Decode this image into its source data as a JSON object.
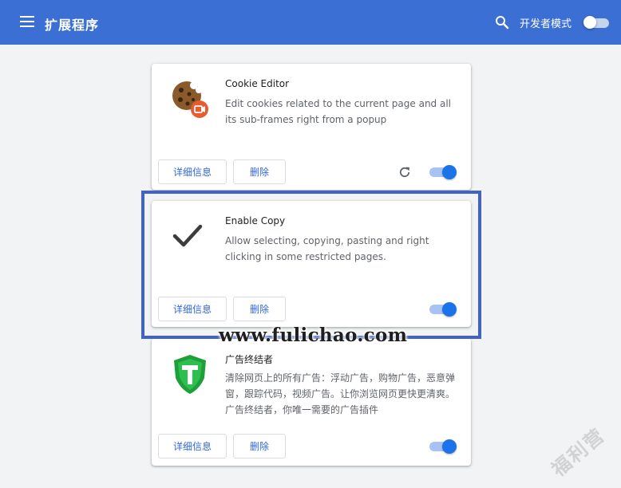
{
  "header": {
    "title": "扩展程序",
    "dev_mode_label": "开发者模式",
    "dev_mode_enabled": false,
    "color": "#3b6fd3"
  },
  "extensions": [
    {
      "name": "Cookie Editor",
      "description": "Edit cookies related to the current page and all its sub-frames right from a popup",
      "details_label": "详细信息",
      "remove_label": "删除",
      "enabled": true,
      "icon": "cookie-icon",
      "has_reload": true
    },
    {
      "name": "Enable Copy",
      "description": "Allow selecting, copying, pasting and right clicking in some restricted pages.",
      "details_label": "详细信息",
      "remove_label": "删除",
      "enabled": true,
      "icon": "checkmark-icon",
      "has_reload": false
    },
    {
      "name": "广告终结者",
      "description": "清除网页上的所有广告：浮动广告，购物广告，恶意弹窗，跟踪代码，视频广告。让你浏览网页更快更清爽。广告终结者，你唯一需要的广告插件",
      "details_label": "详细信息",
      "remove_label": "删除",
      "enabled": true,
      "icon": "shield-t-icon",
      "has_reload": false
    }
  ],
  "watermark": "www.fulichao.com",
  "corner_watermark": "福利营",
  "accent_color": "#1a73e8",
  "highlight_color": "#3f63c8"
}
